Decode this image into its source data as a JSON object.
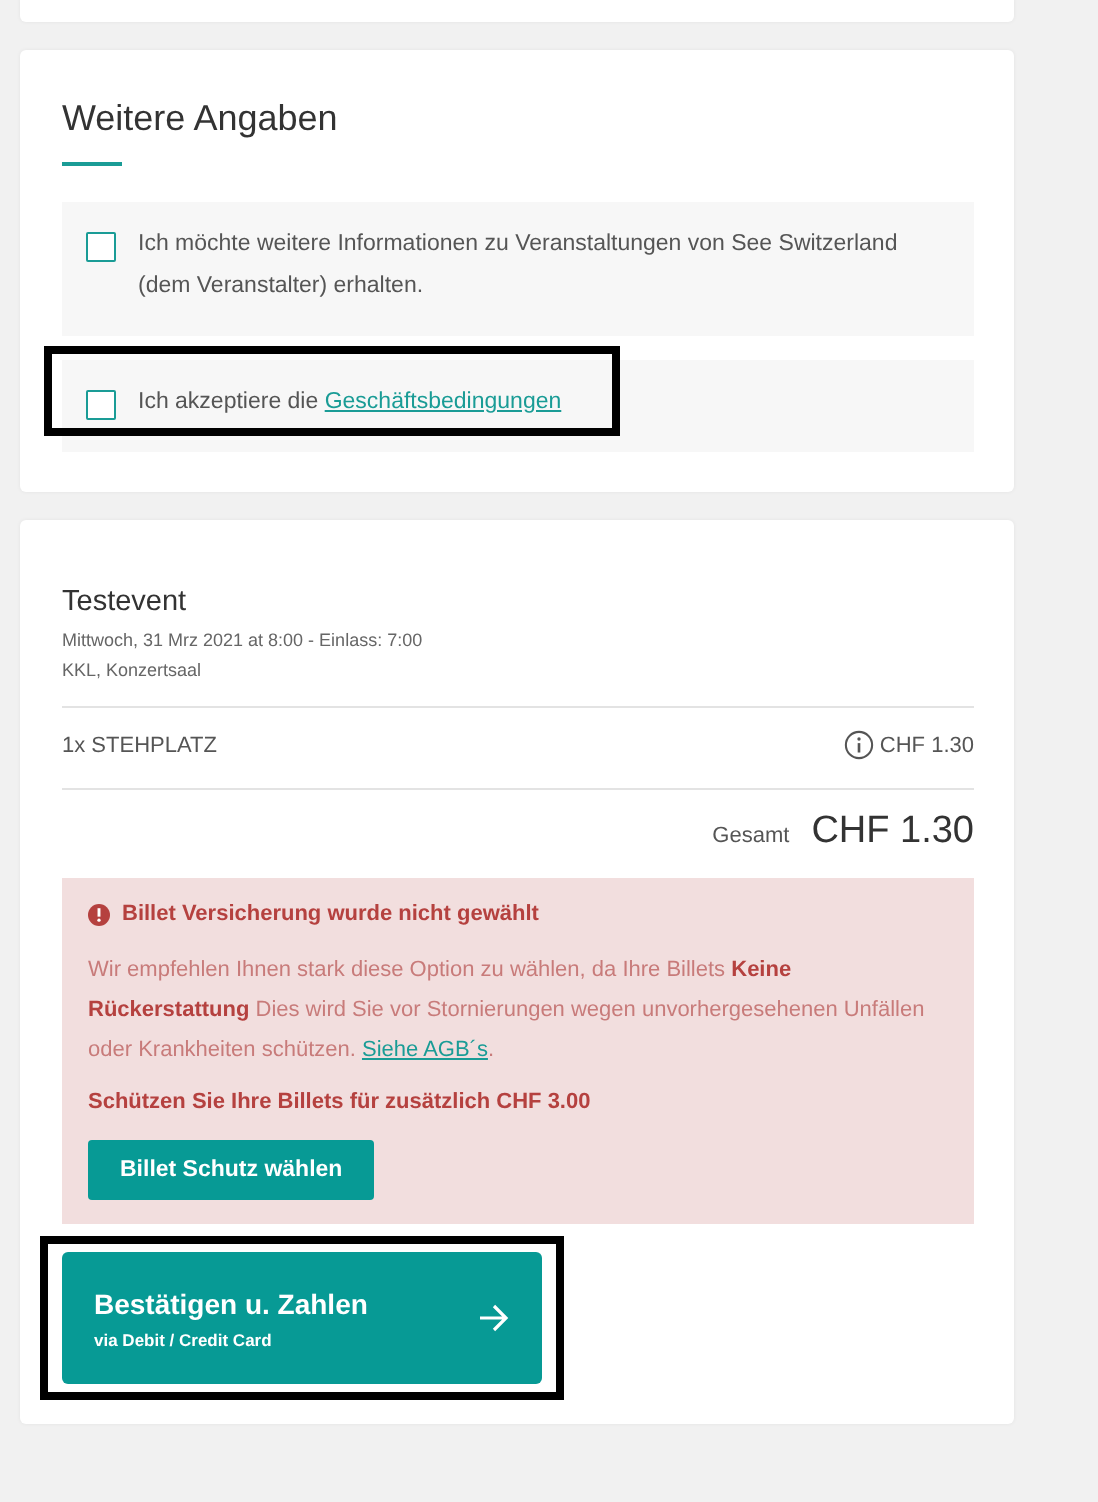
{
  "options_card": {
    "title": "Weitere Angaben",
    "checkboxes": [
      {
        "text": "Ich möchte weitere Informationen zu Veranstaltungen von See Switzerland (dem Veranstalter) erhalten.",
        "checked": false,
        "highlighted": false
      },
      {
        "text": "Ich akzeptiere die ",
        "link": "Geschäftsbedingungen",
        "checked": false,
        "highlighted": true
      }
    ]
  },
  "order_card": {
    "event_title": "Testevent",
    "event_date": "Mittwoch, 31 Mrz 2021 at 8:00 - Einlass: 7:00",
    "venue": "KKL, Konzertsaal",
    "items": [
      {
        "label": "1x STEHPLATZ",
        "price": "CHF 1.30"
      }
    ],
    "total_label": "Gesamt",
    "total": "CHF 1.30",
    "alert": {
      "title": "Billet Versicherung wurde nicht gewählt",
      "text": "Wir empfehlen Ihnen stark diese Option zu wählen, da Ihre Billets **Keine Rückerstattung** Dies wird Sie vor Stornierungen wegen unvorhergesehenen Unfällen oder Krankheiten schützen. ",
      "link": "Siehe AGB´s",
      "after_link": ".",
      "offer": "Schützen Sie Ihre Billets für zusätzlich CHF 3.00",
      "button": "Billet Schutz wählen"
    },
    "pay_button": {
      "label": "Bestätigen u. Zahlen",
      "sublabel": "via Debit / Credit Card",
      "highlighted": true
    }
  }
}
